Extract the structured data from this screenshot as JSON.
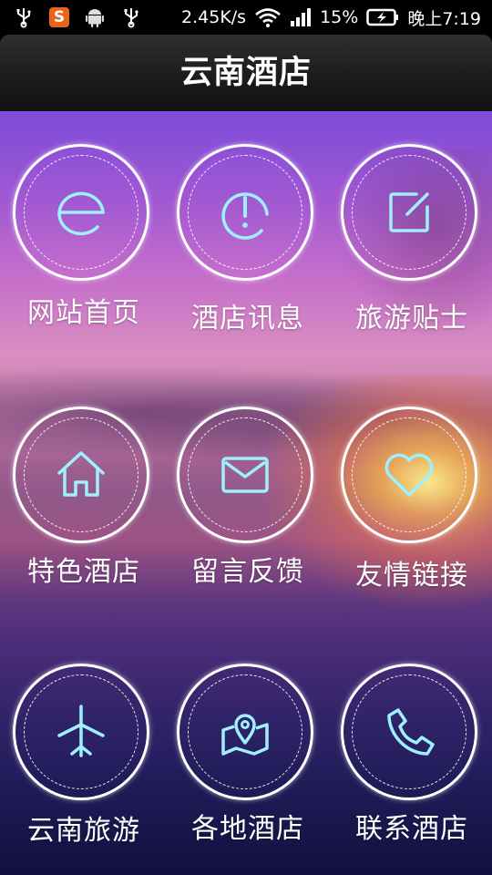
{
  "status_bar": {
    "network_speed": "2.45K/s",
    "battery": "15%",
    "time": "晚上7:19",
    "app_badge": "S",
    "icons": [
      "usb-icon",
      "sogou-app-icon",
      "android-icon",
      "usb-icon",
      "wifi-icon",
      "signal-icon",
      "battery-charging-icon"
    ]
  },
  "header": {
    "title": "云南酒店"
  },
  "menu": {
    "items": [
      {
        "label": "网站首页",
        "icon": "browser-e-icon"
      },
      {
        "label": "酒店讯息",
        "icon": "info-alert-icon"
      },
      {
        "label": "旅游贴士",
        "icon": "edit-note-icon"
      },
      {
        "label": "特色酒店",
        "icon": "home-icon"
      },
      {
        "label": "留言反馈",
        "icon": "mail-icon"
      },
      {
        "label": "友情链接",
        "icon": "heart-icon"
      },
      {
        "label": "云南旅游",
        "icon": "airplane-icon"
      },
      {
        "label": "各地酒店",
        "icon": "map-pin-icon"
      },
      {
        "label": "联系酒店",
        "icon": "phone-icon"
      }
    ]
  },
  "colors": {
    "icon_stroke": "#9ff0ff",
    "circle_border": "#ffffff",
    "title_bar": "#1b1c1e"
  }
}
